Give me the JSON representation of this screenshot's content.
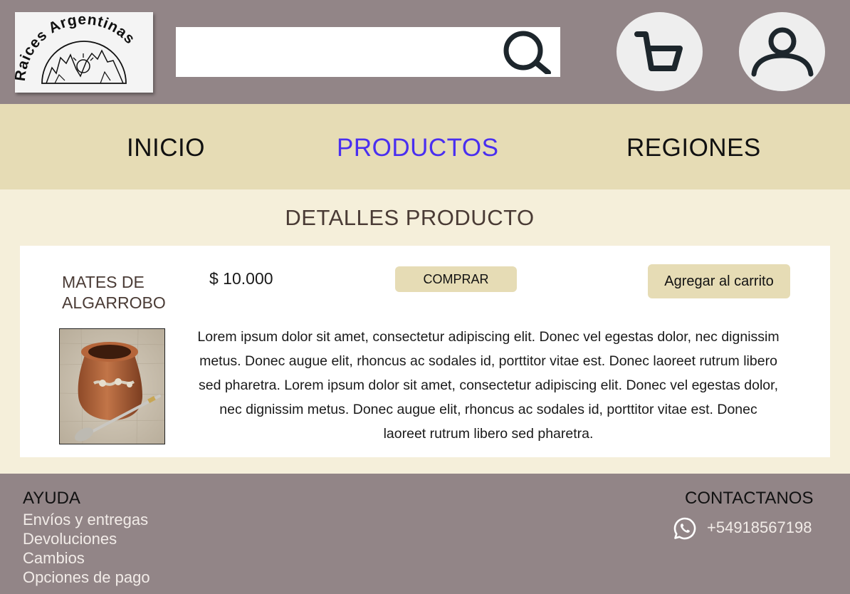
{
  "header": {
    "logo_text": "Raices Argentinas",
    "search": {
      "value": "",
      "placeholder": ""
    }
  },
  "nav": {
    "items": [
      {
        "label": "INICIO",
        "active": false
      },
      {
        "label": "PRODUCTOS",
        "active": true
      },
      {
        "label": "REGIONES",
        "active": false
      }
    ]
  },
  "main": {
    "title": "DETALLES PRODUCTO",
    "product": {
      "name": "MATES DE ALGARROBO",
      "price": "$ 10.000",
      "buy_label": "COMPRAR",
      "add_to_cart_label": "Agregar al carrito",
      "description": "Lorem ipsum dolor sit amet, consectetur  adipiscing elit. Donec vel egestas dolor, nec  dignissim metus.  Donec augue elit, rhoncus ac sodales id, porttitor vitae est.  Donec laoreet  rutrum libero sed pharetra.  Lorem ipsum dolor sit amet, consectetur  adipiscing elit. Donec vel egestas dolor,  nec  dignissim metus.  Donec augue elit, rhoncus ac sodales id, porttitor vitae est.  Donec laoreet  rutrum libero sed pharetra."
    }
  },
  "footer": {
    "help_title": "AYUDA",
    "help_links": [
      "Envíos y entregas",
      "Devoluciones",
      "Cambios",
      "Opciones de pago"
    ],
    "contact_title": "CONTACTANOS",
    "phone": "+54918567198"
  },
  "colors": {
    "header_bg": "#928587",
    "nav_bg": "#e6dcb5",
    "page_bg": "#f5efda",
    "active_nav": "#4a2ff0",
    "button_bg": "#e6dcb5"
  },
  "icons": [
    "logo-icon",
    "search-icon",
    "cart-icon",
    "user-icon",
    "whatsapp-icon"
  ]
}
